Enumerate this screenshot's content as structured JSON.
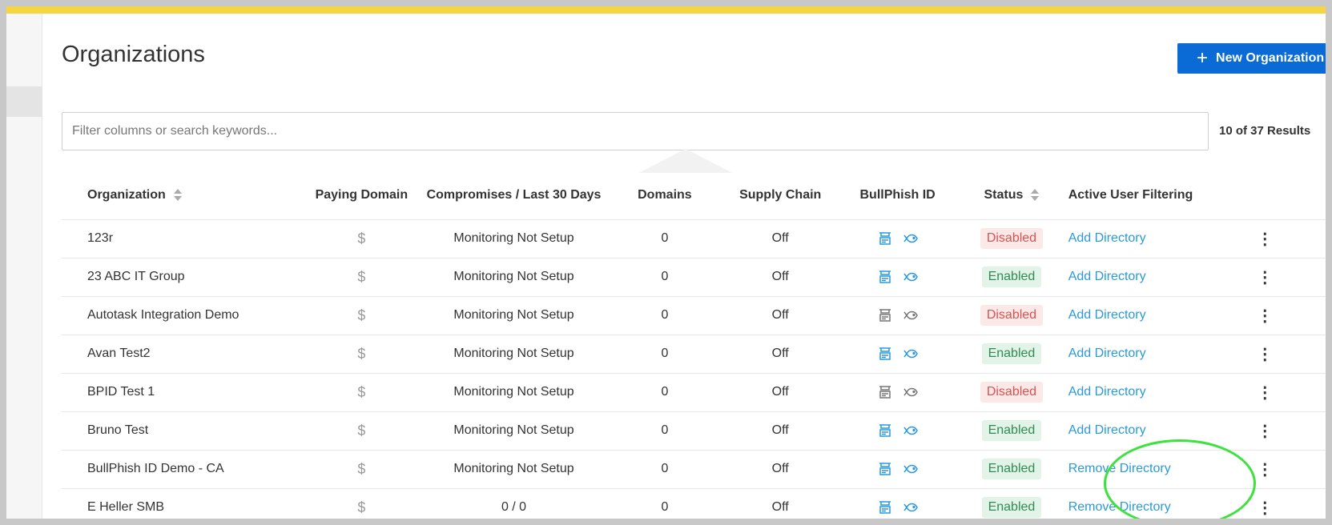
{
  "page": {
    "title": "Organizations",
    "new_button_label": "New Organization",
    "search_placeholder": "Filter columns or search keywords...",
    "results_text": "10 of 37 Results"
  },
  "colors": {
    "accent": "#0a6ad6",
    "topbar": "#f5d540",
    "link": "#2a9ad8",
    "enabled": "#2e8b57",
    "disabled": "#d9534f",
    "highlight_ring": "#3ee23e"
  },
  "table": {
    "headers": {
      "organization": "Organization",
      "paying_domain": "Paying Domain",
      "compromises": "Compromises / Last 30 Days",
      "domains": "Domains",
      "supply_chain": "Supply Chain",
      "bullphish_id": "BullPhish ID",
      "status": "Status",
      "active_user_filtering": "Active User Filtering"
    },
    "rows": [
      {
        "name": "123r",
        "paying": "$",
        "compromises": "Monitoring Not Setup",
        "domains": "0",
        "supply_chain": "Off",
        "bp_active": true,
        "status": "Disabled",
        "directory": "Add Directory"
      },
      {
        "name": "23 ABC IT Group",
        "paying": "$",
        "compromises": "Monitoring Not Setup",
        "domains": "0",
        "supply_chain": "Off",
        "bp_active": true,
        "status": "Enabled",
        "directory": "Add Directory"
      },
      {
        "name": "Autotask Integration Demo",
        "paying": "$",
        "compromises": "Monitoring Not Setup",
        "domains": "0",
        "supply_chain": "Off",
        "bp_active": false,
        "status": "Disabled",
        "directory": "Add Directory"
      },
      {
        "name": "Avan Test2",
        "paying": "$",
        "compromises": "Monitoring Not Setup",
        "domains": "0",
        "supply_chain": "Off",
        "bp_active": true,
        "status": "Enabled",
        "directory": "Add Directory"
      },
      {
        "name": "BPID Test 1",
        "paying": "$",
        "compromises": "Monitoring Not Setup",
        "domains": "0",
        "supply_chain": "Off",
        "bp_active": false,
        "status": "Disabled",
        "directory": "Add Directory"
      },
      {
        "name": "Bruno Test",
        "paying": "$",
        "compromises": "Monitoring Not Setup",
        "domains": "0",
        "supply_chain": "Off",
        "bp_active": true,
        "status": "Enabled",
        "directory": "Add Directory"
      },
      {
        "name": "BullPhish ID Demo - CA",
        "paying": "$",
        "compromises": "Monitoring Not Setup",
        "domains": "0",
        "supply_chain": "Off",
        "bp_active": true,
        "status": "Enabled",
        "directory": "Remove Directory"
      },
      {
        "name": "E Heller SMB",
        "paying": "$",
        "compromises": "0 / 0",
        "domains": "0",
        "supply_chain": "Off",
        "bp_active": true,
        "status": "Enabled",
        "directory": "Remove Directory"
      }
    ]
  },
  "icons": {
    "plus": "plus-icon",
    "sort": "sort-icon",
    "dollar": "dollar-icon",
    "training": "training-icon",
    "phish": "fish-icon",
    "more": "kebab-menu-icon"
  }
}
